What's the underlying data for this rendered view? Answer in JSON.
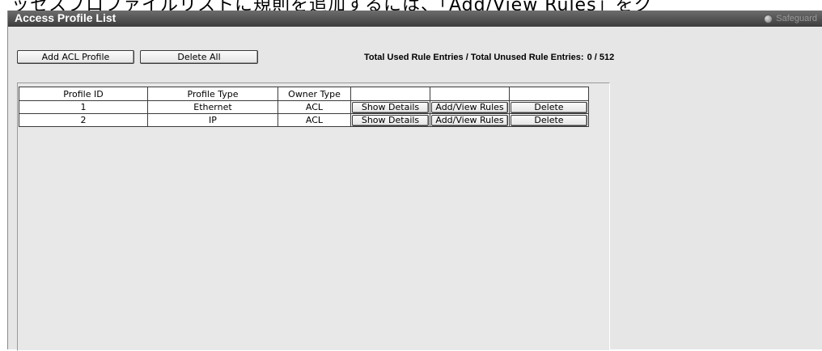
{
  "banner": {
    "text": "ッセスプロファイルリストに規則を追加するには、「Add/View Rules」をク"
  },
  "window": {
    "title": "Access Profile List",
    "safeguard_label": "Safeguard"
  },
  "toolbar": {
    "add_label": "Add ACL Profile",
    "delete_all_label": "Delete All"
  },
  "summary": {
    "label": "Total Used Rule Entries / Total Unused Rule Entries:",
    "value": "0 / 512"
  },
  "table": {
    "headers": [
      "Profile ID",
      "Profile Type",
      "Owner Type",
      "",
      "",
      ""
    ],
    "rows": [
      {
        "id": "1",
        "type": "Ethernet",
        "owner": "ACL",
        "show": "Show Details",
        "rules": "Add/View Rules",
        "delete": "Delete"
      },
      {
        "id": "2",
        "type": "IP",
        "owner": "ACL",
        "show": "Show Details",
        "rules": "Add/View Rules",
        "delete": "Delete"
      }
    ]
  }
}
